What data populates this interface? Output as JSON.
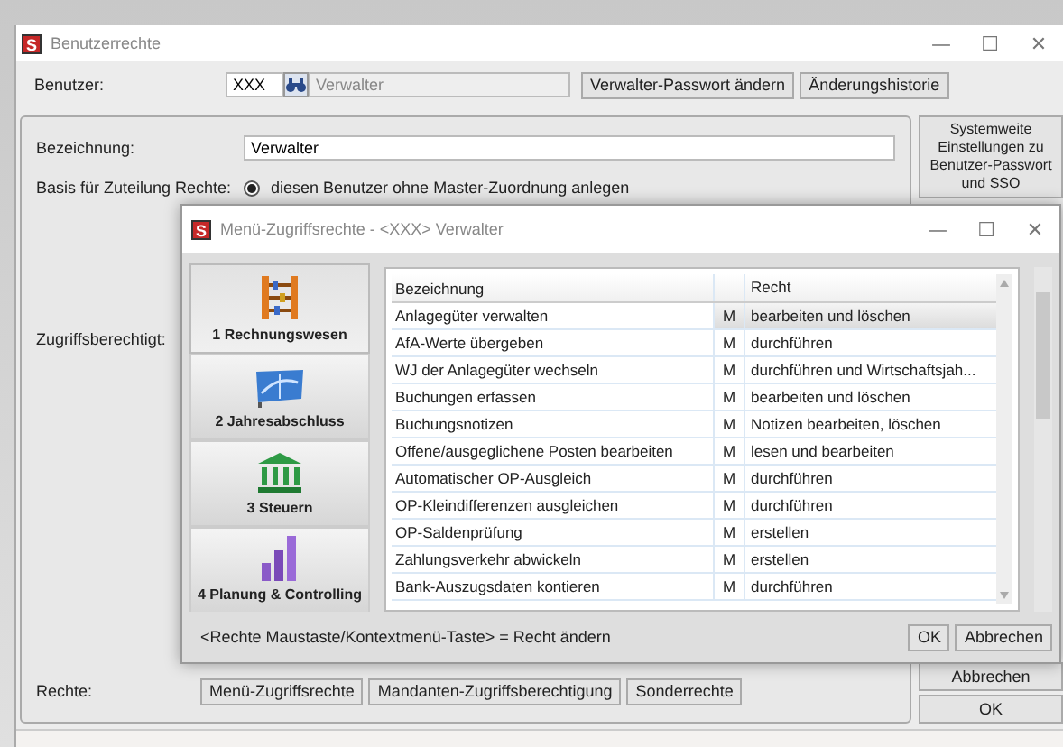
{
  "window": {
    "logo": "S",
    "title": "Benutzerrechte",
    "controls": [
      "—",
      "☐",
      "✕"
    ]
  },
  "user": {
    "label": "Benutzer:",
    "id_value": "XXX",
    "name_value": "Verwalter",
    "buttons": [
      "Verwalter-Passwort ändern",
      "Änderungshistorie"
    ]
  },
  "form": {
    "designation_label": "Bezeichnung:",
    "designation_value": "Verwalter",
    "basis_label": "Basis für Zuteilung Rechte:",
    "basis_option": {
      "label": "diesen Benutzer ohne Master-Zuordnung anlegen",
      "checked": true
    },
    "access_label": "Zugriffsberechtigt:",
    "rights_label": "Rechte:",
    "rights_buttons": [
      "Menü-Zugriffsrechte",
      "Mandanten-Zugriffsberechtigung",
      "Sonderrechte"
    ]
  },
  "side_buttons": [
    "Systemweite Einstellungen zu Benutzer-Passwort und SSO",
    "Abbrechen",
    "OK"
  ],
  "dialog": {
    "logo": "S",
    "title": "Menü-Zugriffsrechte - <XXX> Verwalter",
    "controls": [
      "—",
      "☐",
      "✕"
    ],
    "nav": [
      {
        "label": "1 Rechnungswesen",
        "kind": "abacus",
        "selected": true
      },
      {
        "label": "2 Jahresabschluss",
        "kind": "board",
        "selected": false
      },
      {
        "label": "3 Steuern",
        "kind": "bank",
        "selected": false
      },
      {
        "label": "4 Planung & Controlling",
        "kind": "bars",
        "selected": false
      }
    ],
    "table": {
      "columns": [
        "Bezeichnung",
        "Recht"
      ],
      "rows": [
        {
          "name": "Anlagegüter verwalten",
          "flag": "M",
          "right": "bearbeiten und löschen",
          "selected": true
        },
        {
          "name": "AfA-Werte übergeben",
          "flag": "M",
          "right": "durchführen",
          "selected": false
        },
        {
          "name": "WJ der Anlagegüter wechseln",
          "flag": "M",
          "right": "durchführen und Wirtschaftsjah...",
          "selected": false
        },
        {
          "name": "Buchungen erfassen",
          "flag": "M",
          "right": "bearbeiten und löschen",
          "selected": false
        },
        {
          "name": "Buchungsnotizen",
          "flag": "M",
          "right": "Notizen bearbeiten, löschen",
          "selected": false
        },
        {
          "name": "Offene/ausgeglichene Posten bearbeiten",
          "flag": "M",
          "right": "lesen und bearbeiten",
          "selected": false
        },
        {
          "name": "Automatischer OP-Ausgleich",
          "flag": "M",
          "right": "durchführen",
          "selected": false
        },
        {
          "name": "OP-Kleindifferenzen ausgleichen",
          "flag": "M",
          "right": "durchführen",
          "selected": false
        },
        {
          "name": "OP-Saldenprüfung",
          "flag": "M",
          "right": "erstellen",
          "selected": false
        },
        {
          "name": "Zahlungsverkehr abwickeln",
          "flag": "M",
          "right": "erstellen",
          "selected": false
        },
        {
          "name": "Bank-Auszugsdaten kontieren",
          "flag": "M",
          "right": "durchführen",
          "selected": false
        }
      ]
    },
    "hint": "<Rechte Maustaste/Kontextmenü-Taste> = Recht ändern",
    "buttons": [
      "OK",
      "Abbrechen"
    ]
  }
}
